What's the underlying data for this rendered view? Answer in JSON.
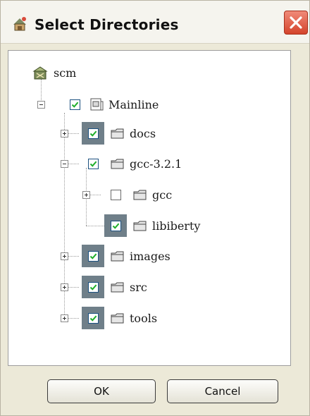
{
  "window": {
    "title": "Select Directories"
  },
  "tree": {
    "root": {
      "label": "scm"
    },
    "mainline": {
      "label": "Mainline",
      "checked": true
    },
    "items": [
      {
        "label": "docs",
        "checked": true
      },
      {
        "label": "gcc-3.2.1",
        "checked": true
      },
      {
        "label": "gcc",
        "checked": false
      },
      {
        "label": "libiberty",
        "checked": true
      },
      {
        "label": "images",
        "checked": true
      },
      {
        "label": "src",
        "checked": true
      },
      {
        "label": "tools",
        "checked": true
      }
    ]
  },
  "buttons": {
    "ok": "OK",
    "cancel": "Cancel"
  },
  "colors": {
    "check": "#1fae2a",
    "checkbox_highlight": "#6f7f89",
    "close_button": "#d4442c"
  }
}
